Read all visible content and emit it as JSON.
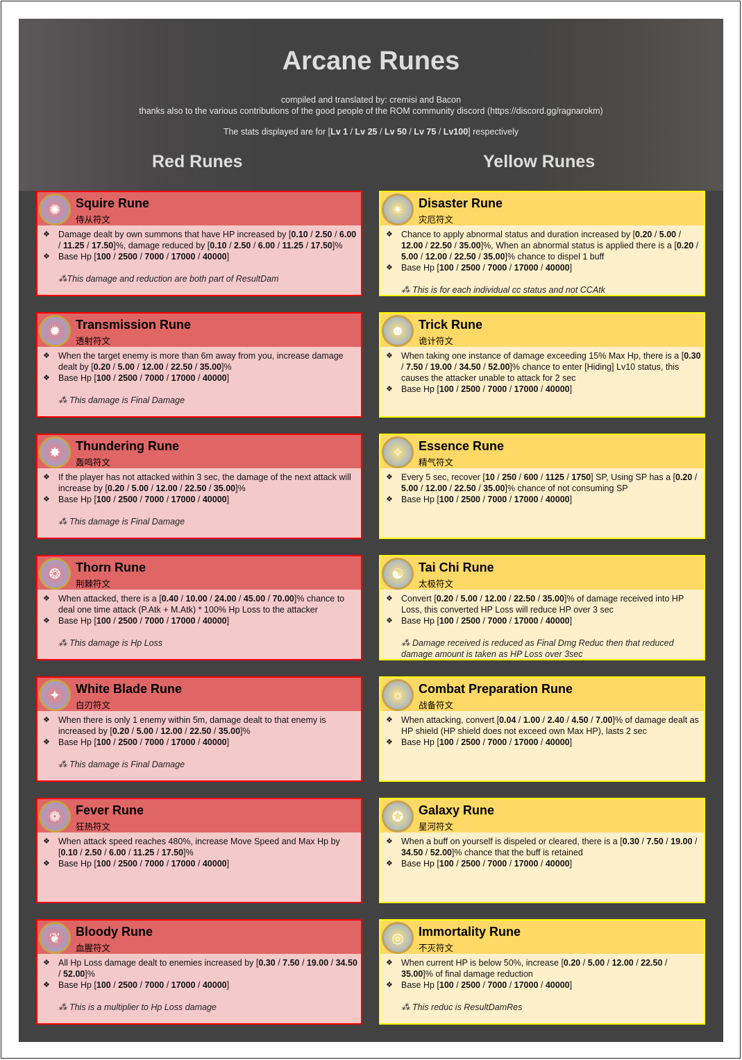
{
  "header": {
    "title": "Arcane Runes",
    "credits": "compiled and translated by: cremisi and Bacon",
    "thanks": "thanks also to the various contributions of the good people of the ROM community discord (https://discord.gg/ragnarokm)",
    "stats_note": "The stats displayed are for [Lv 1 / Lv 25 / Lv 50 / Lv 75 / Lv100] respectively"
  },
  "columns": {
    "red": "Red Runes",
    "yellow": "Yellow Runes"
  },
  "colors": {
    "red_head": "#e06666",
    "red_body": "#f4c9c9",
    "yellow_head": "#ffd966",
    "yellow_body": "#fff0cc"
  },
  "red_runes": [
    {
      "name": "Squire Rune",
      "cn": "侍从符文",
      "icon": "squire-rune-icon",
      "lines": [
        "Damage dealt by own summons that have HP increased by [0.10 / 2.50 / 6.00 / 11.25 / 17.50]%, damage reduced by [0.10 / 2.50 / 6.00 / 11.25 / 17.50]%",
        "Base Hp [100 / 2500 / 7000 / 17000 / 40000]"
      ],
      "note": "⁂This damage and reduction are both part of ResultDam"
    },
    {
      "name": "Transmission Rune",
      "cn": "透射符文",
      "icon": "transmission-rune-icon",
      "lines": [
        "When the target enemy is more than 6m away from you, increase damage dealt by [0.20 / 5.00 / 12.00 / 22.50 / 35.00]%",
        "Base Hp [100 / 2500 / 7000 / 17000 / 40000]"
      ],
      "note": "⁂ This damage is Final Damage"
    },
    {
      "name": "Thundering Rune",
      "cn": "轰鸣符文",
      "icon": "thundering-rune-icon",
      "lines": [
        "If the player has not attacked within 3 sec, the damage of the next attack will increase by [0.20 / 5.00 / 12.00 / 22.50 / 35.00]%",
        "Base Hp [100 / 2500 / 7000 / 17000 / 40000]"
      ],
      "note": "⁂ This damage is Final Damage"
    },
    {
      "name": "Thorn Rune",
      "cn": "荆棘符文",
      "icon": "thorn-rune-icon",
      "lines": [
        "When attacked, there is a [0.40 / 10.00 / 24.00 / 45.00 / 70.00]% chance to deal one time attack (P.Atk + M.Atk) * 100% Hp Loss to the attacker",
        "Base Hp [100 / 2500 / 7000 / 17000 / 40000]"
      ],
      "note": "⁂ This damage is Hp Loss"
    },
    {
      "name": "White Blade Rune",
      "cn": "白刃符文",
      "icon": "white-blade-rune-icon",
      "lines": [
        "When there is only 1 enemy within 5m, damage dealt to that enemy is increased by [0.20 / 5.00 / 12.00 / 22.50 / 35.00]%",
        "Base Hp [100 / 2500 / 7000 / 17000 / 40000]"
      ],
      "note": "⁂ This damage is Final Damage"
    },
    {
      "name": "Fever Rune",
      "cn": "狂热符文",
      "icon": "fever-rune-icon",
      "lines": [
        "When attack speed reaches 480%, increase Move Speed and Max Hp by [0.10 / 2.50 / 6.00 / 11.25 / 17.50]%",
        "Base Hp [100 / 2500 / 7000 / 17000 / 40000]"
      ],
      "note": ""
    },
    {
      "name": "Bloody Rune",
      "cn": "血腥符文",
      "icon": "bloody-rune-icon",
      "lines": [
        "All Hp Loss damage dealt to enemies increased by [0.30 / 7.50 / 19.00 / 34.50 / 52.00]%",
        "Base Hp [100 / 2500 / 7000 / 17000 / 40000]"
      ],
      "note": "⁂ This is a multiplier to Hp Loss damage"
    }
  ],
  "yellow_runes": [
    {
      "name": "Disaster Rune",
      "cn": "灾厄符文",
      "icon": "disaster-rune-icon",
      "lines": [
        "Chance to apply abnormal status and duration increased by [0.20 / 5.00 / 12.00 / 22.50 / 35.00]%, When an abnormal status is applied there is a [0.20 / 5.00 / 12.00 / 22.50 / 35.00]% chance to dispel 1 buff",
        "Base Hp [100 / 2500 / 7000 / 17000 / 40000]"
      ],
      "note": "⁂ This is for each individual cc status and not CCAtk"
    },
    {
      "name": "Trick Rune",
      "cn": "诡计符文",
      "icon": "trick-rune-icon",
      "lines": [
        "When taking one instance of damage exceeding 15% Max Hp, there is a [0.30 / 7.50 / 19.00 / 34.50 / 52.00]% chance to enter [Hiding] Lv10 status, this causes the attacker unable to attack for 2 sec",
        "Base Hp [100 / 2500 / 7000 / 17000 / 40000]"
      ],
      "note": ""
    },
    {
      "name": "Essence Rune",
      "cn": "精气符文",
      "icon": "essence-rune-icon",
      "lines": [
        "Every 5 sec, recover [10 / 250 / 600 / 1125 / 1750] SP, Using SP has a [0.20 / 5.00 / 12.00 / 22.50 / 35.00]% chance of not consuming SP",
        "Base Hp [100 / 2500 / 7000 / 17000 / 40000]"
      ],
      "note": ""
    },
    {
      "name": "Tai Chi Rune",
      "cn": "太极符文",
      "icon": "tai-chi-rune-icon",
      "lines": [
        "Convert [0.20 / 5.00 / 12.00 / 22.50 / 35.00]% of damage received into HP Loss, this converted HP Loss will reduce HP over 3 sec",
        "Base Hp [100 / 2500 / 7000 / 17000 / 40000]"
      ],
      "note": "⁂ Damage received is reduced as Final Dmg Reduc then that reduced damage amount is taken as HP Loss over 3sec"
    },
    {
      "name": "Combat Preparation Rune",
      "cn": "战备符文",
      "icon": "combat-preparation-rune-icon",
      "lines": [
        "When attacking, convert [0.04 / 1.00 / 2.40 / 4.50 / 7.00]% of damage dealt as HP shield (HP shield does not exceed own Max HP), lasts 2 sec",
        "Base Hp [100 / 2500 / 7000 / 17000 / 40000]"
      ],
      "note": ""
    },
    {
      "name": "Galaxy Rune",
      "cn": "星河符文",
      "icon": "galaxy-rune-icon",
      "lines": [
        "When a buff on yourself is dispeled or cleared, there is a [0.30 / 7.50 / 19.00 / 34.50 / 52.00]% chance that the buff is retained",
        "Base Hp [100 / 2500 / 7000 / 17000 / 40000]"
      ],
      "note": ""
    },
    {
      "name": "Immortality Rune",
      "cn": "不灭符文",
      "icon": "immortality-rune-icon",
      "lines": [
        "When current HP is below 50%, increase [0.20 / 5.00 / 12.00 / 22.50 / 35.00]% of final damage reduction",
        "Base Hp [100 / 2500 / 7000 / 17000 / 40000]"
      ],
      "note": "⁂ This reduc is ResultDamRes"
    }
  ]
}
